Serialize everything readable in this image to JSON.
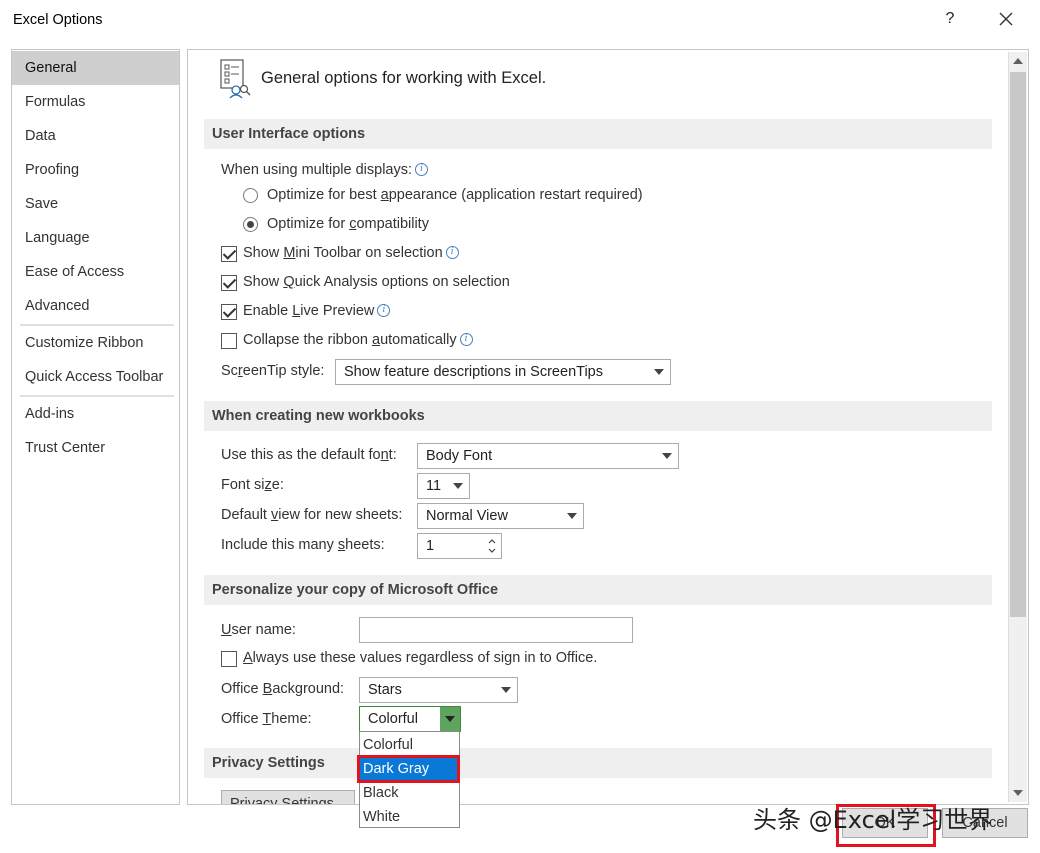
{
  "window": {
    "title": "Excel Options",
    "help_label": "?"
  },
  "nav": {
    "items": [
      {
        "label": "General",
        "active": true
      },
      {
        "label": "Formulas"
      },
      {
        "label": "Data"
      },
      {
        "label": "Proofing"
      },
      {
        "label": "Save"
      },
      {
        "label": "Language"
      },
      {
        "label": "Ease of Access"
      },
      {
        "label": "Advanced"
      },
      {
        "label": "Customize Ribbon"
      },
      {
        "label": "Quick Access Toolbar"
      },
      {
        "label": "Add-ins"
      },
      {
        "label": "Trust Center"
      }
    ]
  },
  "header": {
    "text": "General options for working with Excel."
  },
  "ui_options": {
    "section_title": "User Interface options",
    "multiple_displays_label": "When using multiple displays:",
    "radio_best": {
      "pre": "Optimize for best ",
      "u": "a",
      "post": "ppearance (application restart required)",
      "checked": false
    },
    "radio_compat": {
      "pre": "Optimize for ",
      "u": "c",
      "post": "ompatibility",
      "checked": true
    },
    "mini_toolbar": {
      "pre": "Show ",
      "u": "M",
      "post": "ini Toolbar on selection",
      "checked": true
    },
    "quick_analysis": {
      "pre": "Show ",
      "u": "Q",
      "post": "uick Analysis options on selection",
      "checked": true
    },
    "live_preview": {
      "pre": "Enable ",
      "u": "L",
      "post": "ive Preview",
      "checked": true
    },
    "collapse_ribbon": {
      "pre": "Collapse the ribbon ",
      "u": "a",
      "post": "utomatically",
      "checked": false
    },
    "screentip": {
      "pre": "Sc",
      "u": "r",
      "post": "eenTip style:",
      "value": "Show feature descriptions in ScreenTips"
    }
  },
  "new_workbooks": {
    "section_title": "When creating new workbooks",
    "default_font": {
      "pre": "Use this as the default fo",
      "u": "n",
      "post": "t:",
      "value": "Body Font"
    },
    "font_size": {
      "pre": "Font si",
      "u": "z",
      "post": "e:",
      "value": "11"
    },
    "default_view": {
      "pre": "Default ",
      "u": "v",
      "post": "iew for new sheets:",
      "value": "Normal View"
    },
    "sheets": {
      "pre": "Include this many ",
      "u": "s",
      "post": "heets:",
      "value": "1"
    }
  },
  "personalize": {
    "section_title": "Personalize your copy of Microsoft Office",
    "user_name": {
      "pre": "",
      "u": "U",
      "post": "ser name:",
      "value": ""
    },
    "always_use": {
      "pre": "",
      "u": "A",
      "post": "lways use these values regardless of sign in to Office.",
      "checked": false
    },
    "background": {
      "pre": "Office ",
      "u": "B",
      "post": "ackground:",
      "value": "Stars"
    },
    "theme": {
      "pre": "Office ",
      "u": "T",
      "post": "heme:",
      "value": "Colorful"
    },
    "theme_options": [
      {
        "label": "Colorful"
      },
      {
        "label": "Dark Gray",
        "selected": true
      },
      {
        "label": "Black"
      },
      {
        "label": "White"
      }
    ]
  },
  "privacy": {
    "section_title": "Privacy Settings",
    "button_label": "Privacy Settings..."
  },
  "buttons": {
    "ok_label": "OK",
    "cancel_label": "Cancel"
  },
  "watermark": {
    "text": "头条 @Excel学习世界"
  },
  "colors": {
    "accent": "#0a78d7",
    "highlight": "#e0141e",
    "active_nav": "#cfcfcf",
    "section_bg": "#efefef"
  }
}
